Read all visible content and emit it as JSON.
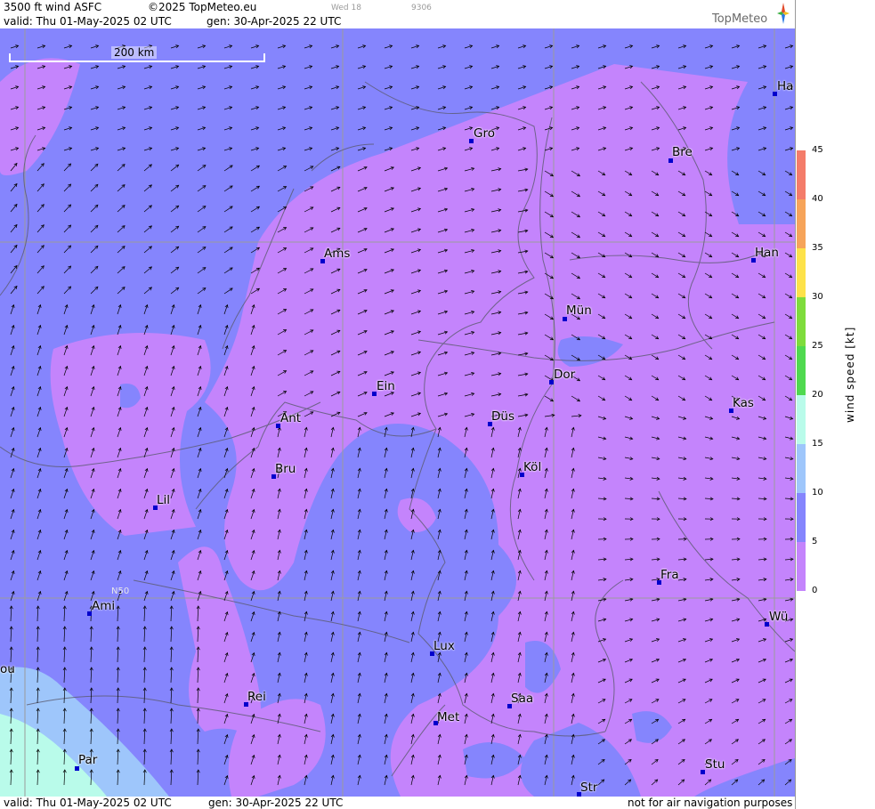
{
  "header": {
    "title": "3500 ft wind ASFC",
    "copyright": "©2025 TopMeteo.eu",
    "tiny_day": "Wed 18",
    "tiny_code": "9306",
    "valid": "valid:  Thu   01-May-2025  02 UTC",
    "gen": "gen: 30-Apr-2025 22 UTC",
    "logo": "TopMeteo"
  },
  "footer": {
    "valid": "valid:  Thu   01-May-2025  02 UTC",
    "gen": "gen: 30-Apr-2025 22 UTC",
    "disclaimer": "not for air navigation purposes"
  },
  "map": {
    "scale_label": "200 km",
    "lat_label": "N50",
    "cities": [
      {
        "name": "Gro"
      },
      {
        "name": "Bre"
      },
      {
        "name": "Ha"
      },
      {
        "name": "Ams"
      },
      {
        "name": "Han"
      },
      {
        "name": "Mün"
      },
      {
        "name": "Dor"
      },
      {
        "name": "Ein"
      },
      {
        "name": "Ant"
      },
      {
        "name": "Düs"
      },
      {
        "name": "Kas"
      },
      {
        "name": "Bru"
      },
      {
        "name": "Köl"
      },
      {
        "name": "Lil"
      },
      {
        "name": "Fra"
      },
      {
        "name": "Ami"
      },
      {
        "name": "Wü"
      },
      {
        "name": "Lux"
      },
      {
        "name": "ou"
      },
      {
        "name": "Rei"
      },
      {
        "name": "Saa"
      },
      {
        "name": "Met"
      },
      {
        "name": "Par"
      },
      {
        "name": "Stu"
      },
      {
        "name": "Str"
      }
    ]
  },
  "legend": {
    "axis_label": "wind  speed  [kt]",
    "ticks": [
      "45",
      "40",
      "35",
      "30",
      "25",
      "20",
      "15",
      "10",
      "5",
      "0"
    ],
    "colors": [
      "#f47c6a",
      "#f6a45a",
      "#fde24a",
      "#7edc3c",
      "#4fd94f",
      "#b9fbea",
      "#9ec6fb",
      "#8585fd",
      "#c484fc"
    ]
  }
}
